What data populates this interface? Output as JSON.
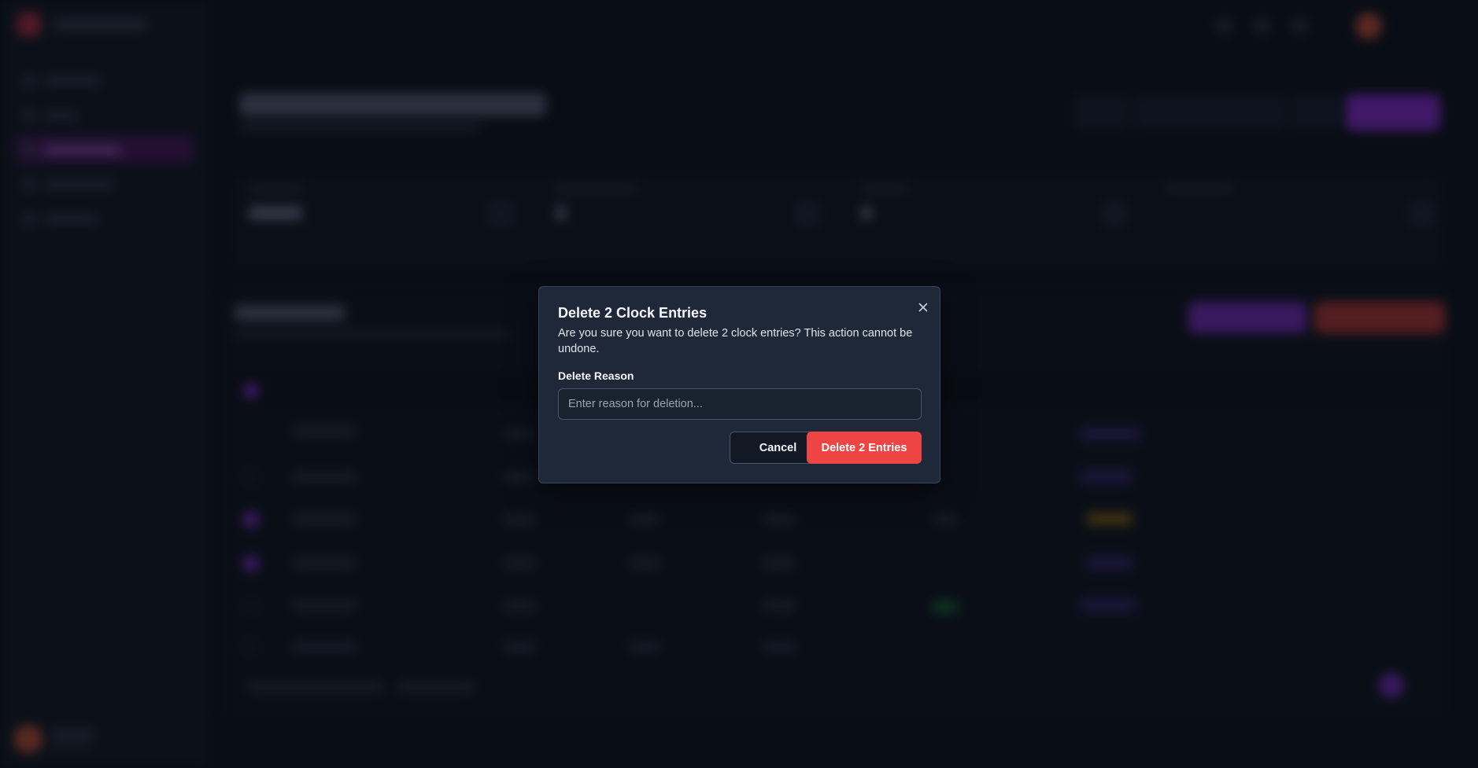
{
  "modal": {
    "title": "Delete 2 Clock Entries",
    "message": "Are you sure you want to delete 2 clock entries? This action cannot be undone.",
    "reason_label": "Delete Reason",
    "reason_placeholder": "Enter reason for deletion...",
    "reason_value": "",
    "cancel_label": "Cancel",
    "confirm_label": "Delete 2 Entries",
    "close_icon": "close-icon"
  },
  "colors": {
    "danger": "#ef4444",
    "accent": "#8a2fd6",
    "modal_bg": "#1e2838",
    "page_bg": "#0f1520"
  }
}
